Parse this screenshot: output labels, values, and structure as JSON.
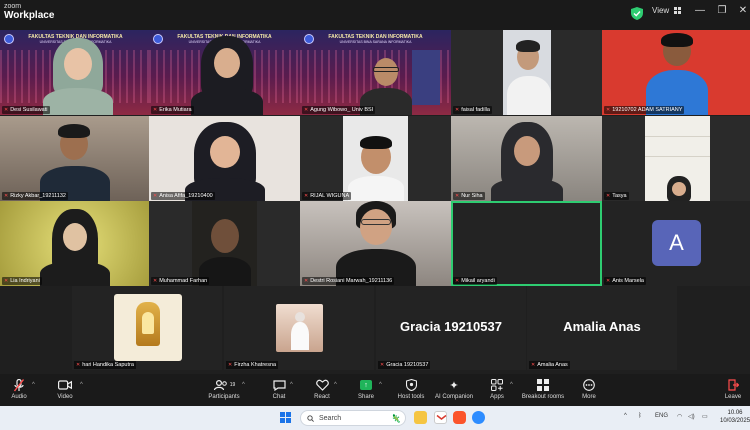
{
  "app": {
    "brand_small": "zoom",
    "brand_large": "Workplace",
    "view_label": "View"
  },
  "window_controls": {
    "minimize": "—",
    "restore": "❐",
    "close": "✕"
  },
  "participants": [
    {
      "name": "Desi Susilawati"
    },
    {
      "name": "Erika Mutiara"
    },
    {
      "name": "Agung Wibowo_ Univ BSI"
    },
    {
      "name": "faisal fadilla"
    },
    {
      "name": "19210702 ADAM SATRIANY"
    },
    {
      "name": "Rizky Akbar_19211132"
    },
    {
      "name": "Anisa Afifa_19210400"
    },
    {
      "name": "RIJAL WIGUNA"
    },
    {
      "name": "Nur Siha"
    },
    {
      "name": "Tasya"
    },
    {
      "name": "Lia Indriyani"
    },
    {
      "name": "Muhammad Farhan"
    },
    {
      "name": "Destri Rosiani Marwah_19211136"
    },
    {
      "name": "Mikail aryandi"
    },
    {
      "name": "Anis Marsela",
      "avatar_letter": "A"
    }
  ],
  "banner": {
    "line1": "FAKULTAS TEKNIK DAN INFORMATIKA",
    "line2": "UNIVERSITAS BINA SARANA INFORMATIKA"
  },
  "bottom_participants": [
    {
      "name": "hari Handika Saputra"
    },
    {
      "name": "Firzha Khatresna"
    },
    {
      "name": "Gracia 19210537",
      "big_name": "Gracia 19210537"
    },
    {
      "name": "Amalia Anas",
      "big_name": "Amalia Anas"
    }
  ],
  "toolbar": {
    "audio": "Audio",
    "video": "Video",
    "participants": "Participants",
    "participants_count": "19",
    "chat": "Chat",
    "react": "React",
    "share": "Share",
    "host_tools": "Host tools",
    "ai_companion": "AI Companion",
    "apps": "Apps",
    "breakout_rooms": "Breakout rooms",
    "more": "More",
    "leave": "Leave"
  },
  "taskbar": {
    "search_placeholder": "Search",
    "language": "ENG",
    "time": "10.06",
    "date": "10/03/2025"
  },
  "colors": {
    "active_speaker_border": "#2ecc71",
    "avatar_bg": "#5865b8",
    "share_green": "#1fb45a",
    "leave_red": "#ff4d4d",
    "adam_bg": "#d93a2f"
  }
}
